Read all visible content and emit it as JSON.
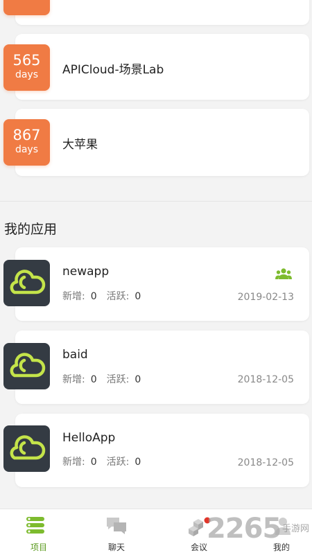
{
  "projects": [
    {
      "days": "",
      "unit": "days",
      "name": ""
    },
    {
      "days": "565",
      "unit": "days",
      "name": "APICloud-场景Lab"
    },
    {
      "days": "867",
      "unit": "days",
      "name": "大苹果"
    }
  ],
  "section_title": "我的应用",
  "stats_labels": {
    "new": "新增:",
    "active": "活跃:"
  },
  "apps": [
    {
      "name": "newapp",
      "new": "0",
      "active": "0",
      "date": "2019-02-13",
      "has_group_icon": true
    },
    {
      "name": "baid",
      "new": "0",
      "active": "0",
      "date": "2018-12-05",
      "has_group_icon": false
    },
    {
      "name": "HelloApp",
      "new": "0",
      "active": "0",
      "date": "2018-12-05",
      "has_group_icon": false
    }
  ],
  "tabs": [
    {
      "label": "项目",
      "active": true
    },
    {
      "label": "聊天",
      "active": false
    },
    {
      "label": "会议",
      "active": false
    },
    {
      "label": "我的",
      "active": false
    }
  ],
  "watermark": {
    "number": "2265",
    "site": "手游网"
  },
  "colors": {
    "badge": "#f07b44",
    "accent_green": "#7dbb2e",
    "app_icon_bg": "#343b43",
    "app_icon_fg": "#c4e44a"
  }
}
